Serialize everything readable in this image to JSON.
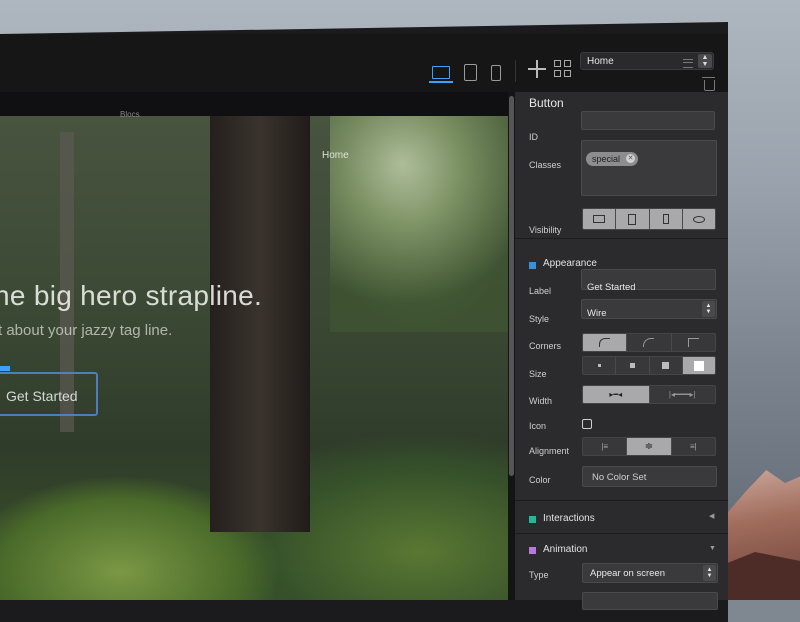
{
  "toolbar": {
    "device_icons": [
      "laptop-icon",
      "tablet-icon",
      "phone-icon"
    ],
    "page_select": "Home"
  },
  "canvas": {
    "blocks_label": "Blocs",
    "nav_home": "Home",
    "hero_title": "he big hero strapline.",
    "hero_subtitle": "t about your jazzy tag line.",
    "cta_label": "Get Started"
  },
  "panel": {
    "title": "Button",
    "id_label": "ID",
    "id_value": "",
    "classes_label": "Classes",
    "class_tag": "special",
    "visibility_label": "Visibility",
    "appearance": {
      "title": "Appearance",
      "color": "#3b8fd6",
      "label_label": "Label",
      "label_value": "Get Started",
      "style_label": "Style",
      "style_value": "Wire",
      "corners_label": "Corners",
      "size_label": "Size",
      "width_label": "Width",
      "icon_label": "Icon",
      "alignment_label": "Alignment",
      "color_label": "Color",
      "color_value": "No Color Set"
    },
    "interactions": {
      "title": "Interactions",
      "color": "#2bb39b"
    },
    "animation": {
      "title": "Animation",
      "color": "#b77ad8",
      "type_label": "Type",
      "type_value": "Appear on screen"
    }
  },
  "colors": {
    "accent": "#3ea0ff",
    "panel_bg": "#2b2b2d"
  }
}
